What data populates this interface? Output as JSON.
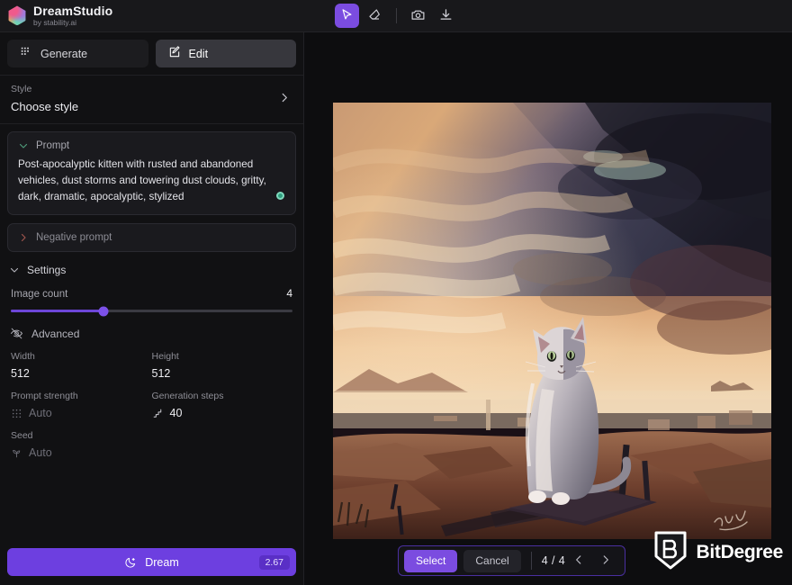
{
  "brand": {
    "name": "DreamStudio",
    "subtitle": "by stability.ai",
    "logo_icon": "gradient-hexagon-logo"
  },
  "toolbar": {
    "tools": [
      {
        "name": "cursor-tool",
        "icon": "cursor-arrow-icon",
        "active": true
      },
      {
        "name": "eraser-tool",
        "icon": "eraser-icon",
        "active": false
      },
      {
        "name": "camera-tool",
        "icon": "camera-icon",
        "active": false
      },
      {
        "name": "download-tool",
        "icon": "download-icon",
        "active": false
      }
    ]
  },
  "sidebar": {
    "tabs": [
      {
        "label": "Generate",
        "icon": "grid-squares-icon",
        "active": false
      },
      {
        "label": "Edit",
        "icon": "pencil-square-icon",
        "active": true
      }
    ],
    "style": {
      "label": "Style",
      "value": "Choose style",
      "chevron_icon": "chevron-right-icon"
    },
    "prompt": {
      "title": "Prompt",
      "chevron_icon": "chevron-down-icon",
      "text": "Post-apocalyptic kitten with rusted and abandoned vehicles, dust storms and towering dust clouds, gritty, dark, dramatic, apocalyptic, stylized",
      "status_dot": "green-status-dot"
    },
    "negative_prompt": {
      "label": "Negative prompt",
      "chevron_icon": "chevron-right-icon"
    },
    "settings": {
      "title": "Settings",
      "chevron_icon": "chevron-down-icon",
      "image_count": {
        "label": "Image count",
        "value": "4",
        "fill_percent": 33
      },
      "advanced": {
        "label": "Advanced",
        "icon": "eye-off-icon"
      },
      "width": {
        "label": "Width",
        "value": "512"
      },
      "height": {
        "label": "Height",
        "value": "512"
      },
      "prompt_strength": {
        "label": "Prompt strength",
        "value": "Auto",
        "icon": "dots-grid-icon"
      },
      "generation_steps": {
        "label": "Generation steps",
        "value": "40",
        "icon": "steps-icon"
      },
      "seed": {
        "label": "Seed",
        "value": "Auto",
        "icon": "sprout-icon"
      }
    },
    "dream_button": {
      "label": "Dream",
      "icon": "moon-icon",
      "credits": "2.67"
    }
  },
  "canvas": {
    "artwork_alt": "Post-apocalyptic kitten sitting on rubble under a dusty sky"
  },
  "bottom_bar": {
    "select_label": "Select",
    "cancel_label": "Cancel",
    "counter": "4 / 4",
    "prev_icon": "chevron-left-icon",
    "next_icon": "chevron-right-icon"
  },
  "watermark": {
    "text": "BitDegree",
    "icon": "bitdegree-shield-icon"
  },
  "colors": {
    "accent_purple": "#7b4ce0",
    "dream_purple": "#6d3fe0",
    "panel_bg": "#111113",
    "canvas_bg": "#0d0d0f",
    "status_green": "#2f9e7e"
  }
}
